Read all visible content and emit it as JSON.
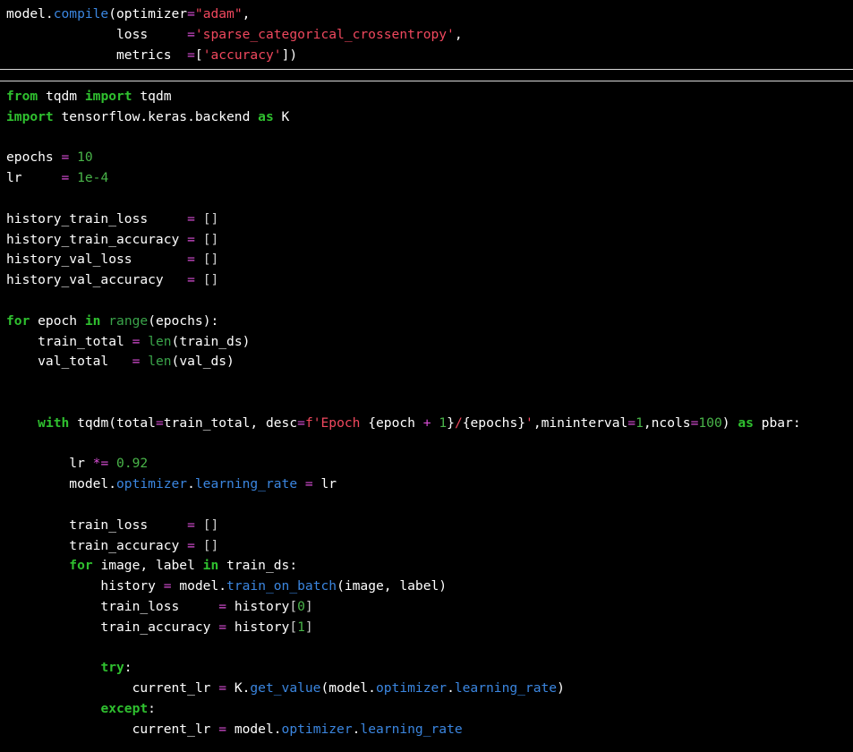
{
  "colors": {
    "background": "#000000",
    "text": "#ffffff",
    "keyword": "#2fc02f",
    "operator": "#d94ed6",
    "number": "#49b549",
    "string": "#f0485e",
    "attribute": "#3b86e0",
    "builtin": "#3aa44a",
    "separator": "#d8d8d8"
  },
  "cells": [
    {
      "lines": [
        [
          [
            "txt",
            "model."
          ],
          [
            "fn",
            "compile"
          ],
          [
            "txt",
            "(optimizer"
          ],
          [
            "op",
            "="
          ],
          [
            "str",
            "\"adam\""
          ],
          [
            "txt",
            ","
          ]
        ],
        [
          [
            "txt",
            "              loss     "
          ],
          [
            "op",
            "="
          ],
          [
            "str",
            "'sparse_categorical_crossentropy'"
          ],
          [
            "txt",
            ","
          ]
        ],
        [
          [
            "txt",
            "              metrics  "
          ],
          [
            "op",
            "="
          ],
          [
            "txt",
            "["
          ],
          [
            "str",
            "'accuracy'"
          ],
          [
            "txt",
            "])"
          ]
        ]
      ]
    },
    {
      "lines": [
        [
          [
            "kw",
            "from"
          ],
          [
            "txt",
            " tqdm "
          ],
          [
            "kw",
            "import"
          ],
          [
            "txt",
            " tqdm"
          ]
        ],
        [
          [
            "kw",
            "import"
          ],
          [
            "txt",
            " tensorflow.keras.backend "
          ],
          [
            "kw",
            "as"
          ],
          [
            "txt",
            " K"
          ]
        ],
        [],
        [
          [
            "txt",
            "epochs "
          ],
          [
            "op",
            "="
          ],
          [
            "txt",
            " "
          ],
          [
            "num",
            "10"
          ]
        ],
        [
          [
            "txt",
            "lr     "
          ],
          [
            "op",
            "="
          ],
          [
            "txt",
            " "
          ],
          [
            "num",
            "1e-4"
          ]
        ],
        [],
        [
          [
            "txt",
            "history_train_loss     "
          ],
          [
            "op",
            "="
          ],
          [
            "txt",
            " "
          ],
          [
            "br",
            "[]"
          ]
        ],
        [
          [
            "txt",
            "history_train_accuracy "
          ],
          [
            "op",
            "="
          ],
          [
            "txt",
            " "
          ],
          [
            "br",
            "[]"
          ]
        ],
        [
          [
            "txt",
            "history_val_loss       "
          ],
          [
            "op",
            "="
          ],
          [
            "txt",
            " "
          ],
          [
            "br",
            "[]"
          ]
        ],
        [
          [
            "txt",
            "history_val_accuracy   "
          ],
          [
            "op",
            "="
          ],
          [
            "txt",
            " "
          ],
          [
            "br",
            "[]"
          ]
        ],
        [],
        [
          [
            "kw",
            "for"
          ],
          [
            "txt",
            " epoch "
          ],
          [
            "kw",
            "in"
          ],
          [
            "txt",
            " "
          ],
          [
            "bi",
            "range"
          ],
          [
            "txt",
            "(epochs):"
          ]
        ],
        [
          [
            "txt",
            "    train_total "
          ],
          [
            "op",
            "="
          ],
          [
            "txt",
            " "
          ],
          [
            "bi",
            "len"
          ],
          [
            "txt",
            "(train_ds)"
          ]
        ],
        [
          [
            "txt",
            "    val_total   "
          ],
          [
            "op",
            "="
          ],
          [
            "txt",
            " "
          ],
          [
            "bi",
            "len"
          ],
          [
            "txt",
            "(val_ds)"
          ]
        ],
        [],
        [],
        [
          [
            "txt",
            "    "
          ],
          [
            "kw",
            "with"
          ],
          [
            "txt",
            " tqdm(total"
          ],
          [
            "op",
            "="
          ],
          [
            "txt",
            "train_total, desc"
          ],
          [
            "op",
            "="
          ],
          [
            "str",
            "f'Epoch "
          ],
          [
            "txt",
            "{epoch "
          ],
          [
            "op",
            "+"
          ],
          [
            "txt",
            " "
          ],
          [
            "num",
            "1"
          ],
          [
            "txt",
            "}"
          ],
          [
            "str",
            "/"
          ],
          [
            "txt",
            "{epochs}"
          ],
          [
            "str",
            "'"
          ],
          [
            "txt",
            ",mininterval"
          ],
          [
            "op",
            "="
          ],
          [
            "num",
            "1"
          ],
          [
            "txt",
            ",ncols"
          ],
          [
            "op",
            "="
          ],
          [
            "num",
            "100"
          ],
          [
            "txt",
            ") "
          ],
          [
            "kw",
            "as"
          ],
          [
            "txt",
            " pbar:"
          ]
        ],
        [],
        [
          [
            "txt",
            "        lr "
          ],
          [
            "op",
            "*="
          ],
          [
            "txt",
            " "
          ],
          [
            "num",
            "0.92"
          ]
        ],
        [
          [
            "txt",
            "        model."
          ],
          [
            "fn",
            "optimizer"
          ],
          [
            "txt",
            "."
          ],
          [
            "fn",
            "learning_rate"
          ],
          [
            "txt",
            " "
          ],
          [
            "op",
            "="
          ],
          [
            "txt",
            " lr"
          ]
        ],
        [],
        [
          [
            "txt",
            "        train_loss     "
          ],
          [
            "op",
            "="
          ],
          [
            "txt",
            " "
          ],
          [
            "br",
            "[]"
          ]
        ],
        [
          [
            "txt",
            "        train_accuracy "
          ],
          [
            "op",
            "="
          ],
          [
            "txt",
            " "
          ],
          [
            "br",
            "[]"
          ]
        ],
        [
          [
            "txt",
            "        "
          ],
          [
            "kw",
            "for"
          ],
          [
            "txt",
            " image, label "
          ],
          [
            "kw",
            "in"
          ],
          [
            "txt",
            " train_ds:"
          ]
        ],
        [
          [
            "txt",
            "            history "
          ],
          [
            "op",
            "="
          ],
          [
            "txt",
            " model."
          ],
          [
            "fn",
            "train_on_batch"
          ],
          [
            "txt",
            "(image, label)"
          ]
        ],
        [
          [
            "txt",
            "            train_loss     "
          ],
          [
            "op",
            "="
          ],
          [
            "txt",
            " history"
          ],
          [
            "br",
            "["
          ],
          [
            "num",
            "0"
          ],
          [
            "br",
            "]"
          ]
        ],
        [
          [
            "txt",
            "            train_accuracy "
          ],
          [
            "op",
            "="
          ],
          [
            "txt",
            " history"
          ],
          [
            "br",
            "["
          ],
          [
            "num",
            "1"
          ],
          [
            "br",
            "]"
          ]
        ],
        [],
        [
          [
            "txt",
            "            "
          ],
          [
            "kw",
            "try"
          ],
          [
            "txt",
            ":"
          ]
        ],
        [
          [
            "txt",
            "                current_lr "
          ],
          [
            "op",
            "="
          ],
          [
            "txt",
            " K."
          ],
          [
            "fn",
            "get_value"
          ],
          [
            "txt",
            "(model."
          ],
          [
            "fn",
            "optimizer"
          ],
          [
            "txt",
            "."
          ],
          [
            "fn",
            "learning_rate"
          ],
          [
            "txt",
            ")"
          ]
        ],
        [
          [
            "txt",
            "            "
          ],
          [
            "kw",
            "except"
          ],
          [
            "txt",
            ":"
          ]
        ],
        [
          [
            "txt",
            "                current_lr "
          ],
          [
            "op",
            "="
          ],
          [
            "txt",
            " model."
          ],
          [
            "fn",
            "optimizer"
          ],
          [
            "txt",
            "."
          ],
          [
            "fn",
            "learning_rate"
          ]
        ]
      ]
    }
  ]
}
